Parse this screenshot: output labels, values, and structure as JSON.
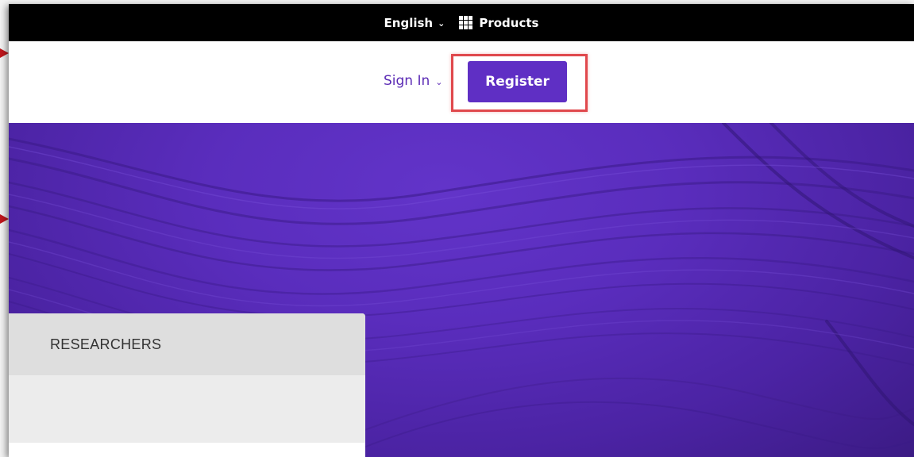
{
  "topbar": {
    "language_label": "English",
    "products_label": "Products",
    "language_chevron": "⌄",
    "products_icon": "grid-icon"
  },
  "header": {
    "signin_label": "Sign In",
    "signin_chevron": "⌄",
    "register_label": "Register"
  },
  "hero": {
    "tab_label": "RESEARCHERS"
  },
  "colors": {
    "brand_purple": "#5f2fc4",
    "topbar_bg": "#000000",
    "highlight_red": "#e0484c",
    "arrow_red": "#c0161c"
  }
}
